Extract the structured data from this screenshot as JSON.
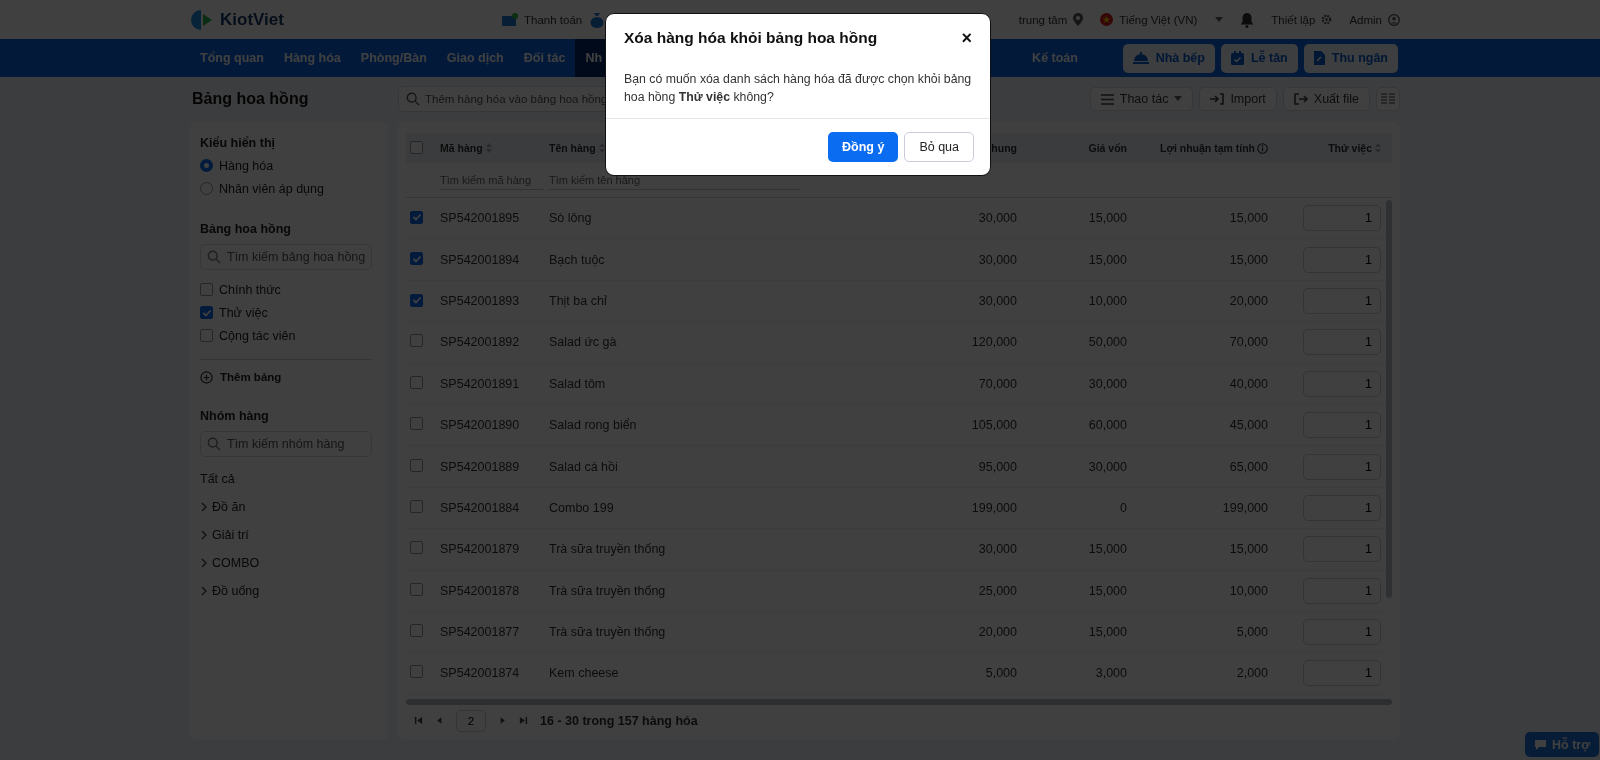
{
  "topbar": {
    "logo": "KiotViet",
    "payment": "Thanh toán",
    "branch": "trung tâm",
    "language": "Tiếng Việt (VN)",
    "settings": "Thiết lập",
    "user": "Admin"
  },
  "nav": {
    "items": [
      {
        "label": "Tổng quan",
        "selected": false
      },
      {
        "label": "Hàng hóa",
        "selected": false
      },
      {
        "label": "Phòng/Bàn",
        "selected": false
      },
      {
        "label": "Giao dịch",
        "selected": false
      },
      {
        "label": "Đối tác",
        "selected": false
      },
      {
        "label": "Nh",
        "selected": true
      },
      {
        "label": "Kế toán",
        "selected": false
      }
    ],
    "buttons": [
      {
        "label": "Nhà bếp",
        "kind": "kitchen"
      },
      {
        "label": "Lễ tân",
        "kind": "reception"
      },
      {
        "label": "Thu ngân",
        "kind": "cashier"
      }
    ]
  },
  "page_title": "Bảng hoa hồng",
  "sidebar": {
    "display_heading": "Kiểu hiển thị",
    "display_modes": [
      {
        "label": "Hàng hóa",
        "selected": true
      },
      {
        "label": "Nhân viên áp dụng",
        "selected": false
      }
    ],
    "tables_heading": "Bảng hoa hồng",
    "tables_search": {
      "placeholder": "Tìm kiếm bảng hoa hồng"
    },
    "tables": [
      {
        "label": "Chính thức",
        "checked": false
      },
      {
        "label": "Thử việc",
        "checked": true
      },
      {
        "label": "Cộng tác viên",
        "checked": false
      }
    ],
    "add_table": "Thêm bảng",
    "groups_heading": "Nhóm hàng",
    "groups_search": {
      "placeholder": "Tìm kiếm nhóm hàng"
    },
    "all_label": "Tất cả",
    "groups": [
      {
        "label": "Đồ ăn",
        "expanded": false
      },
      {
        "label": "Giải trí",
        "expanded": false
      },
      {
        "label": "COMBO",
        "expanded": false
      },
      {
        "label": "Đồ uống",
        "expanded": false
      }
    ]
  },
  "toolbar": {
    "search": {
      "placeholder": "Thêm hàng hóa vào bảng hoa hồng"
    },
    "buttons": [
      {
        "label": "Thao tác",
        "kind": "actions"
      },
      {
        "label": "Import",
        "kind": "import"
      },
      {
        "label": "Xuất file",
        "kind": "export"
      },
      {
        "kind": "columns"
      }
    ]
  },
  "table": {
    "all_selected": false,
    "columns": [
      {
        "label": "Mã hàng",
        "sortable": true,
        "info": false
      },
      {
        "label": "Tên hàng",
        "sortable": true,
        "info": false
      },
      {
        "label": "hung",
        "sortable": false,
        "info": false
      },
      {
        "label": "Giá vốn",
        "sortable": false,
        "info": false
      },
      {
        "label": "Lợi nhuận tạm tính",
        "sortable": false,
        "info": true
      },
      {
        "label": "Thử việc",
        "sortable": true,
        "info": false
      }
    ],
    "filters": [
      {
        "placeholder": "Tìm kiếm mã hàng"
      },
      {
        "placeholder": "Tìm kiếm tên hàng"
      }
    ],
    "rows": [
      {
        "code": "SP542001895",
        "name": "Sò lông",
        "price": "30,000",
        "cost": "15,000",
        "profit": "15,000",
        "rate": "1",
        "selected": true
      },
      {
        "code": "SP542001894",
        "name": "Bạch tuộc",
        "price": "30,000",
        "cost": "15,000",
        "profit": "15,000",
        "rate": "1",
        "selected": true
      },
      {
        "code": "SP542001893",
        "name": "Thịt ba chỉ",
        "price": "30,000",
        "cost": "10,000",
        "profit": "20,000",
        "rate": "1",
        "selected": true
      },
      {
        "code": "SP542001892",
        "name": "Salad ức gà",
        "price": "120,000",
        "cost": "50,000",
        "profit": "70,000",
        "rate": "1",
        "selected": false
      },
      {
        "code": "SP542001891",
        "name": "Salad tôm",
        "price": "70,000",
        "cost": "30,000",
        "profit": "40,000",
        "rate": "1",
        "selected": false
      },
      {
        "code": "SP542001890",
        "name": "Salad rong biển",
        "price": "105,000",
        "cost": "60,000",
        "profit": "45,000",
        "rate": "1",
        "selected": false
      },
      {
        "code": "SP542001889",
        "name": "Salad cá hồi",
        "price": "95,000",
        "cost": "30,000",
        "profit": "65,000",
        "rate": "1",
        "selected": false
      },
      {
        "code": "SP542001884",
        "name": "Combo 199",
        "price": "199,000",
        "cost": "0",
        "profit": "199,000",
        "rate": "1",
        "selected": false
      },
      {
        "code": "SP542001879",
        "name": "Trà sữa truyền thống",
        "price": "30,000",
        "cost": "15,000",
        "profit": "15,000",
        "rate": "1",
        "selected": false
      },
      {
        "code": "SP542001878",
        "name": "Trà sữa truyền thống",
        "price": "25,000",
        "cost": "15,000",
        "profit": "10,000",
        "rate": "1",
        "selected": false
      },
      {
        "code": "SP542001877",
        "name": "Trà sữa truyền thống",
        "price": "20,000",
        "cost": "15,000",
        "profit": "5,000",
        "rate": "1",
        "selected": false
      },
      {
        "code": "SP542001874",
        "name": "Kem cheese",
        "price": "5,000",
        "cost": "3,000",
        "profit": "2,000",
        "rate": "1",
        "selected": false
      }
    ]
  },
  "pagination": {
    "page": "2",
    "summary": "16 - 30 trong 157 hàng hóa"
  },
  "help": "Hỗ trợ",
  "modal": {
    "title": "Xóa hàng hóa khỏi bảng hoa hồng",
    "close": "×",
    "message": "Bạn có muốn xóa danh sách hàng hóa đã được chọn khỏi bảng hoa hồng **Thử việc** không?",
    "confirm": "Đồng ý",
    "cancel": "Bỏ qua"
  }
}
